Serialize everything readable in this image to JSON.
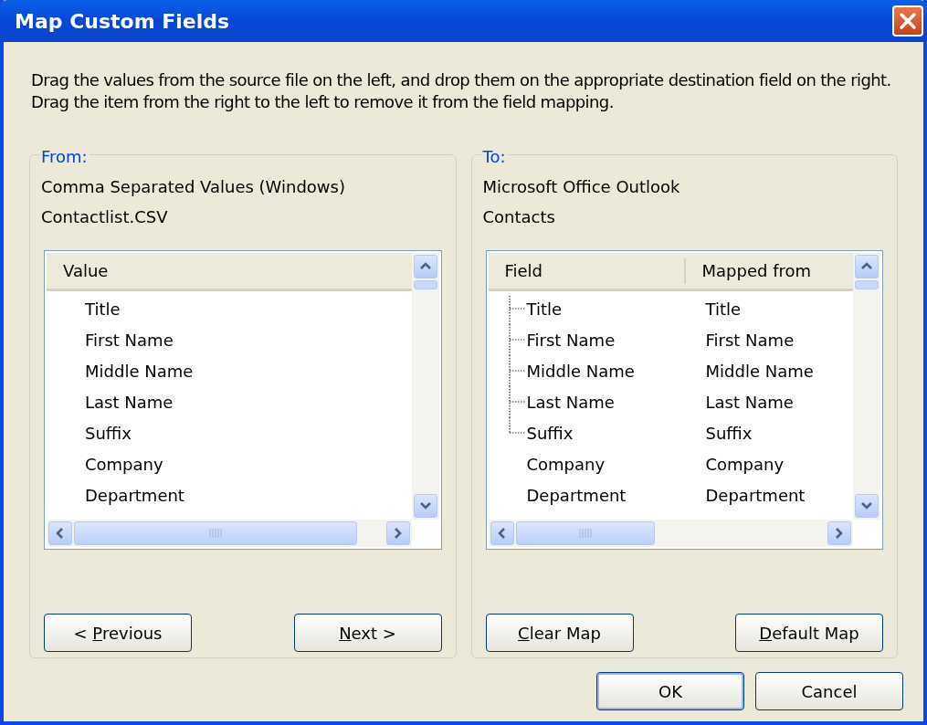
{
  "window": {
    "title": "Map Custom Fields"
  },
  "instructions": "Drag the values from the source file on the left, and drop them on the appropriate destination field on the right.  Drag the item from the right to the left to remove it from the field mapping.",
  "from": {
    "legend": "From:",
    "lines": [
      "Comma Separated Values (Windows)",
      "Contactlist.CSV"
    ],
    "columns": [
      "Value"
    ],
    "rows": [
      [
        "Title"
      ],
      [
        "First Name"
      ],
      [
        "Middle Name"
      ],
      [
        "Last Name"
      ],
      [
        "Suffix"
      ],
      [
        "Company"
      ],
      [
        "Department"
      ]
    ],
    "buttons": [
      {
        "pre": "< ",
        "key": "P",
        "post": "revious"
      },
      {
        "key": "N",
        "post": "ext >"
      }
    ]
  },
  "to": {
    "legend": "To:",
    "lines": [
      "Microsoft Office Outlook",
      "Contacts"
    ],
    "columns": [
      "Field",
      "Mapped from"
    ],
    "rows": [
      {
        "cells": [
          "Title",
          "Title"
        ],
        "connector": true
      },
      {
        "cells": [
          "First Name",
          "First Name"
        ],
        "connector": true
      },
      {
        "cells": [
          "Middle Name",
          "Middle Name"
        ],
        "connector": true
      },
      {
        "cells": [
          "Last Name",
          "Last Name"
        ],
        "connector": true
      },
      {
        "cells": [
          "Suffix",
          "Suffix"
        ],
        "connector": true
      },
      {
        "cells": [
          "Company",
          "Company"
        ],
        "connector": false
      },
      {
        "cells": [
          "Department",
          "Department"
        ],
        "connector": false
      }
    ],
    "buttons": [
      {
        "key": "C",
        "post": "lear Map"
      },
      {
        "key": "D",
        "post": "efault Map"
      }
    ]
  },
  "dialog_buttons": [
    {
      "label": "OK",
      "default": true
    },
    {
      "label": "Cancel",
      "default": false
    }
  ]
}
